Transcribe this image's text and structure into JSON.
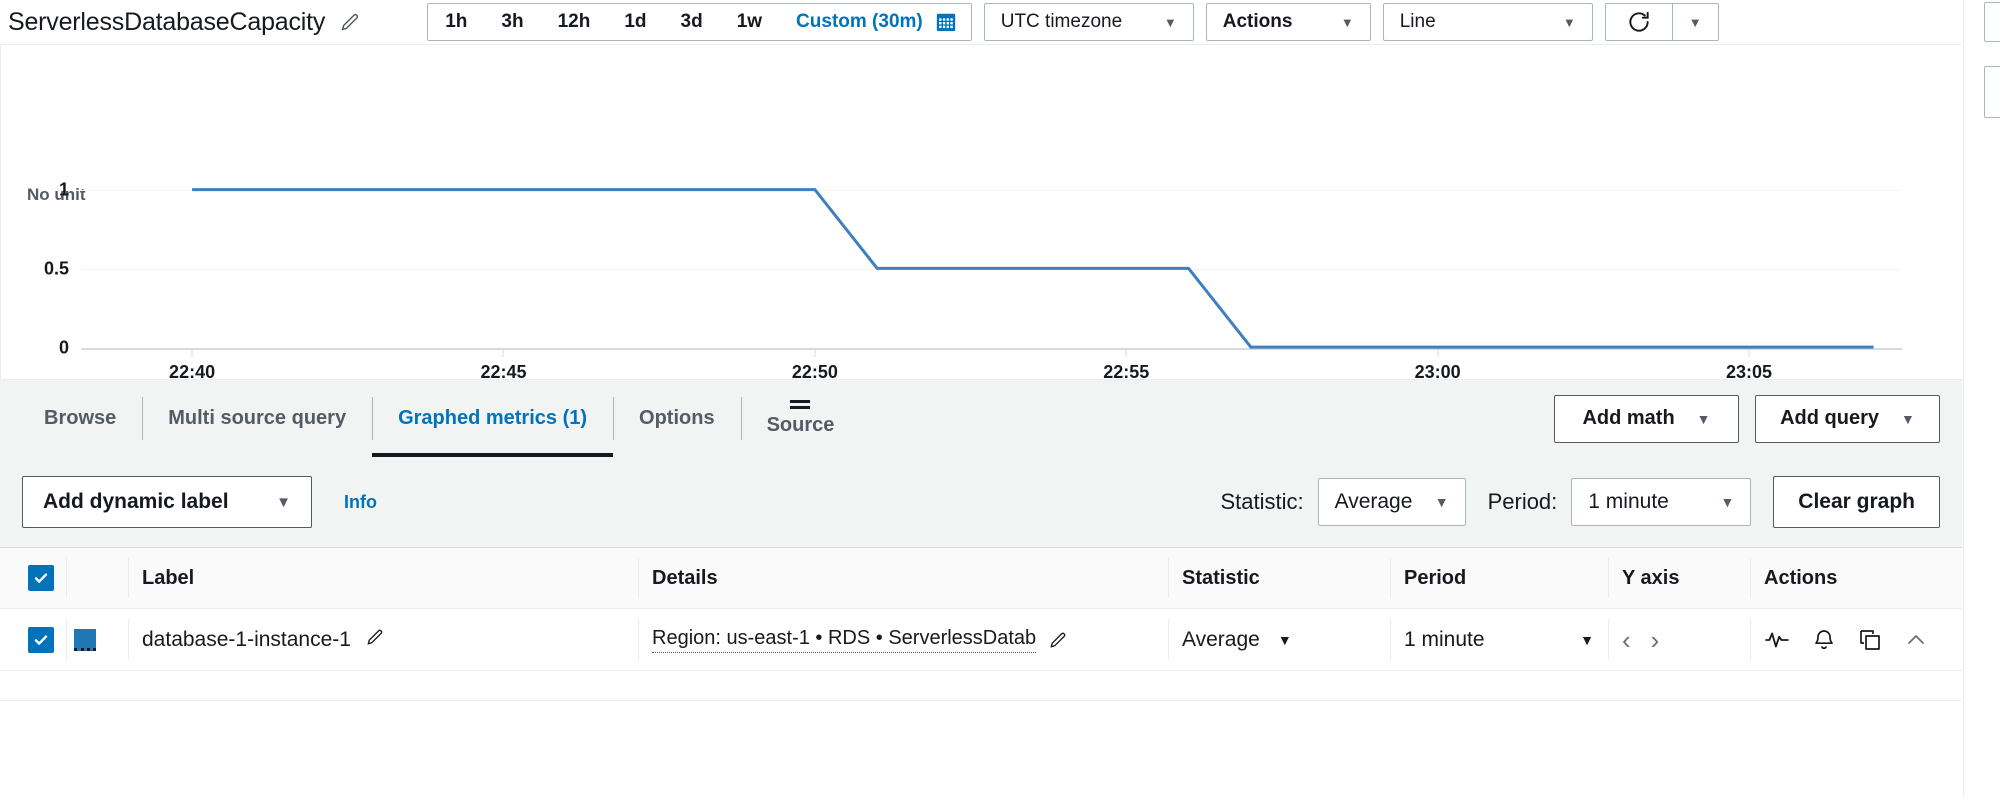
{
  "header": {
    "graph_title": "ServerlessDatabaseCapacity",
    "edit_icon": "pencil-icon",
    "time_ranges": [
      "1h",
      "3h",
      "12h",
      "1d",
      "3d",
      "1w"
    ],
    "custom_range": "Custom (30m)",
    "calendar_icon": "calendar-icon",
    "timezone": "UTC timezone",
    "actions": "Actions",
    "chart_type": "Line",
    "refresh_icon": "refresh-icon",
    "caret": "▼"
  },
  "chart_data": {
    "type": "line",
    "title": "",
    "xlabel": "",
    "ylabel": "No unit",
    "ylim": [
      0,
      1
    ],
    "yticks": [
      "1",
      "0.5",
      "0"
    ],
    "ytick_values": [
      1,
      0.5,
      0
    ],
    "xticks": [
      "22:40",
      "22:45",
      "22:50",
      "22:55",
      "23:00",
      "23:05"
    ],
    "grid": true,
    "legend": "none",
    "series": [
      {
        "name": "database-1-instance-1",
        "color": "#3f7fbf",
        "x": [
          "22:40",
          "22:41",
          "22:42",
          "22:43",
          "22:44",
          "22:45",
          "22:46",
          "22:47",
          "22:48",
          "22:49",
          "22:50",
          "22:51",
          "22:52",
          "22:53",
          "22:54",
          "22:55",
          "22:56",
          "22:57",
          "22:58",
          "22:59",
          "23:00",
          "23:01",
          "23:02",
          "23:03",
          "23:04",
          "23:05",
          "23:06",
          "23:07"
        ],
        "values": [
          1,
          1,
          1,
          1,
          1,
          1,
          1,
          1,
          1,
          1,
          1,
          0.5,
          0.5,
          0.5,
          0.5,
          0.5,
          0.5,
          0,
          0,
          0,
          0,
          0,
          0,
          0,
          0,
          0,
          0,
          0
        ]
      }
    ]
  },
  "tabs": [
    {
      "label": "Browse",
      "active": false
    },
    {
      "label": "Multi source query",
      "active": false
    },
    {
      "label": "Graphed metrics (1)",
      "active": true
    },
    {
      "label": "Options",
      "active": false
    },
    {
      "label": "Source",
      "active": false
    }
  ],
  "tab_actions": {
    "add_math": "Add math",
    "add_query": "Add query",
    "caret": "▼"
  },
  "controls": {
    "add_dynamic_label": "Add dynamic label",
    "info": "Info",
    "statistic_label": "Statistic:",
    "statistic_value": "Average",
    "period_label": "Period:",
    "period_value": "1 minute",
    "clear_graph": "Clear graph",
    "caret": "▼"
  },
  "table": {
    "columns": [
      "Label",
      "Details",
      "Statistic",
      "Period",
      "Y axis",
      "Actions"
    ],
    "rows": [
      {
        "checked": true,
        "color": "#1f77b4",
        "label": "database-1-instance-1",
        "details": "Region: us-east-1 • RDS • ServerlessDatab",
        "statistic": "Average",
        "period": "1 minute",
        "caret": "▼",
        "yaxis_left": "‹",
        "yaxis_right": "›",
        "actions": [
          "anomaly-detection-icon",
          "alarm-bell-icon",
          "duplicate-icon",
          "collapse-chevron-icon"
        ]
      }
    ]
  }
}
